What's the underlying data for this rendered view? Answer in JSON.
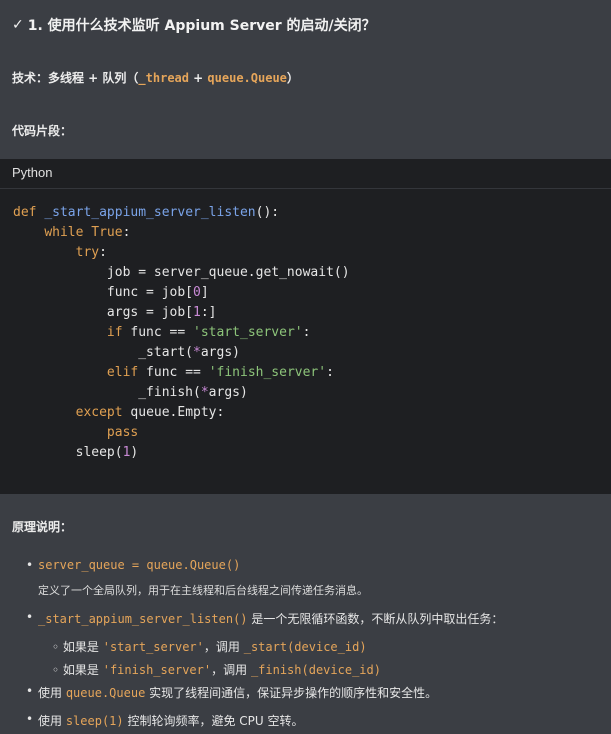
{
  "heading": {
    "check": "✅",
    "title": "1. 使用什么技术监听 Appium Server 的启动/关闭？"
  },
  "tech": {
    "prefix": "技术：多线程 + 队列（",
    "thread": "_thread",
    "plus": " + ",
    "queue": "queue.Queue",
    "suffix": "）"
  },
  "snippet_label": "代码片段：",
  "code": {
    "language": "Python",
    "lines": [
      "def _start_appium_server_listen():",
      "    while True:",
      "        try:",
      "            job = server_queue.get_nowait()",
      "            func = job[0]",
      "            args = job[1:]",
      "            if func == 'start_server':",
      "                _start(*args)",
      "            elif func == 'finish_server':",
      "                _finish(*args)",
      "        except queue.Empty:",
      "            pass",
      "        sleep(1)"
    ]
  },
  "principle_label": "原理说明：",
  "bullets": {
    "b1_code": "server_queue = queue.Queue()",
    "b1_text": "定义了一个全局队列，用于在主线程和后台线程之间传递任务消息。",
    "b2_code": "_start_appium_server_listen()",
    "b2_text": " 是一个无限循环函数，不断从队列中取出任务：",
    "sub1_prefix": "如果是 ",
    "sub1_code": "'start_server'",
    "sub1_mid": "，调用 ",
    "sub1_call": "_start(device_id)",
    "sub2_prefix": "如果是 ",
    "sub2_code": "'finish_server'",
    "sub2_mid": "，调用 ",
    "sub2_call": "_finish(device_id)",
    "b3_prefix": "使用 ",
    "b3_code": "queue.Queue",
    "b3_text": " 实现了线程间通信，保证异步操作的顺序性和安全性。",
    "b4_prefix": "使用 ",
    "b4_code": "sleep(1)",
    "b4_text": " 控制轮询频率，避免 CPU 空转。"
  }
}
